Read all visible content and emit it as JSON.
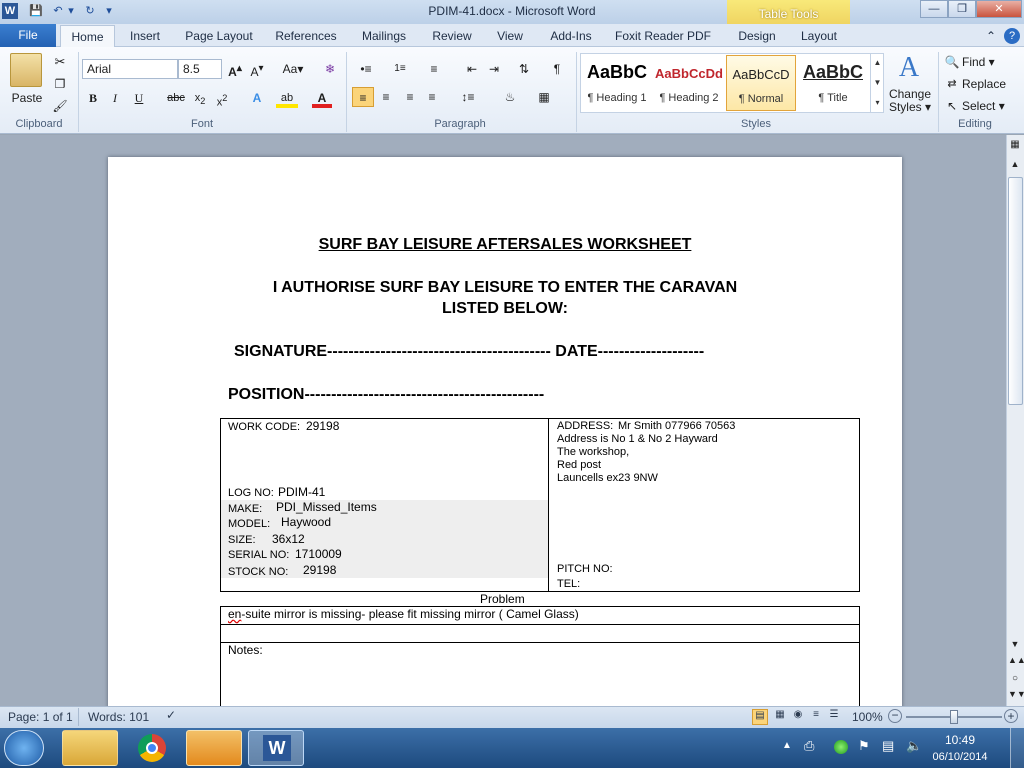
{
  "window": {
    "title": "PDIM-41.docx - Microsoft Word",
    "table_tools": "Table Tools"
  },
  "tabs": [
    "File",
    "Home",
    "Insert",
    "Page Layout",
    "References",
    "Mailings",
    "Review",
    "View",
    "Add-Ins",
    "Foxit Reader PDF",
    "Design",
    "Layout"
  ],
  "clipboard": {
    "paste": "Paste",
    "label": "Clipboard"
  },
  "font": {
    "name": "Arial",
    "size": "8.5",
    "label": "Font"
  },
  "paragraph": {
    "label": "Paragraph"
  },
  "styles": {
    "label": "Styles",
    "items": [
      {
        "preview": "AaBbC",
        "name": "¶ Heading 1"
      },
      {
        "preview": "AaBbCcDd",
        "name": "¶ Heading 2"
      },
      {
        "preview": "AaBbCcD",
        "name": "¶ Normal"
      },
      {
        "preview": "AaBbC",
        "name": "¶ Title"
      }
    ],
    "change_line1": "Change",
    "change_line2": "Styles"
  },
  "editing": {
    "find": "Find",
    "replace": "Replace",
    "select": "Select",
    "label": "Editing"
  },
  "document": {
    "heading": "SURF BAY LEISURE AFTERSALES WORKSHEET",
    "authorise_line1": "I AUTHORISE SURF BAY LEISURE TO ENTER THE CARAVAN",
    "authorise_line2": "LISTED BELOW:",
    "signature_line": "SIGNATURE------------------------------------------ DATE--------------------",
    "position_line": "POSITION---------------------------------------------",
    "work_code_label": "WORK CODE:",
    "work_code": "29198",
    "log_no_label": "LOG NO:",
    "log_no": "PDIM-41",
    "make_label": "MAKE:",
    "make": "PDI_Missed_Items",
    "model_label": "MODEL:",
    "model": "Haywood",
    "size_label": "SIZE:",
    "size": "36x12",
    "serial_label": "SERIAL  NO:",
    "serial": "1710009",
    "stock_label": "STOCK NO:",
    "stock": "29198",
    "address_label": "ADDRESS:",
    "address_lines": [
      "Mr Smith 077966 70563",
      "Address is No 1 & No 2 Hayward",
      "The workshop,",
      "Red post",
      "Launcells ex23 9NW"
    ],
    "pitch_label": "PITCH NO:",
    "tel_label": "TEL:",
    "problem_header": "Problem",
    "problem_text_a": "en",
    "problem_text_b": "-suite mirror is missing- please fit  missing mirror ( Camel Glass)",
    "notes_label": "Notes:"
  },
  "status": {
    "page": "Page: 1 of 1",
    "words": "Words: 101",
    "zoom": "100%"
  },
  "clock": {
    "time": "10:49",
    "date": "06/10/2014"
  }
}
